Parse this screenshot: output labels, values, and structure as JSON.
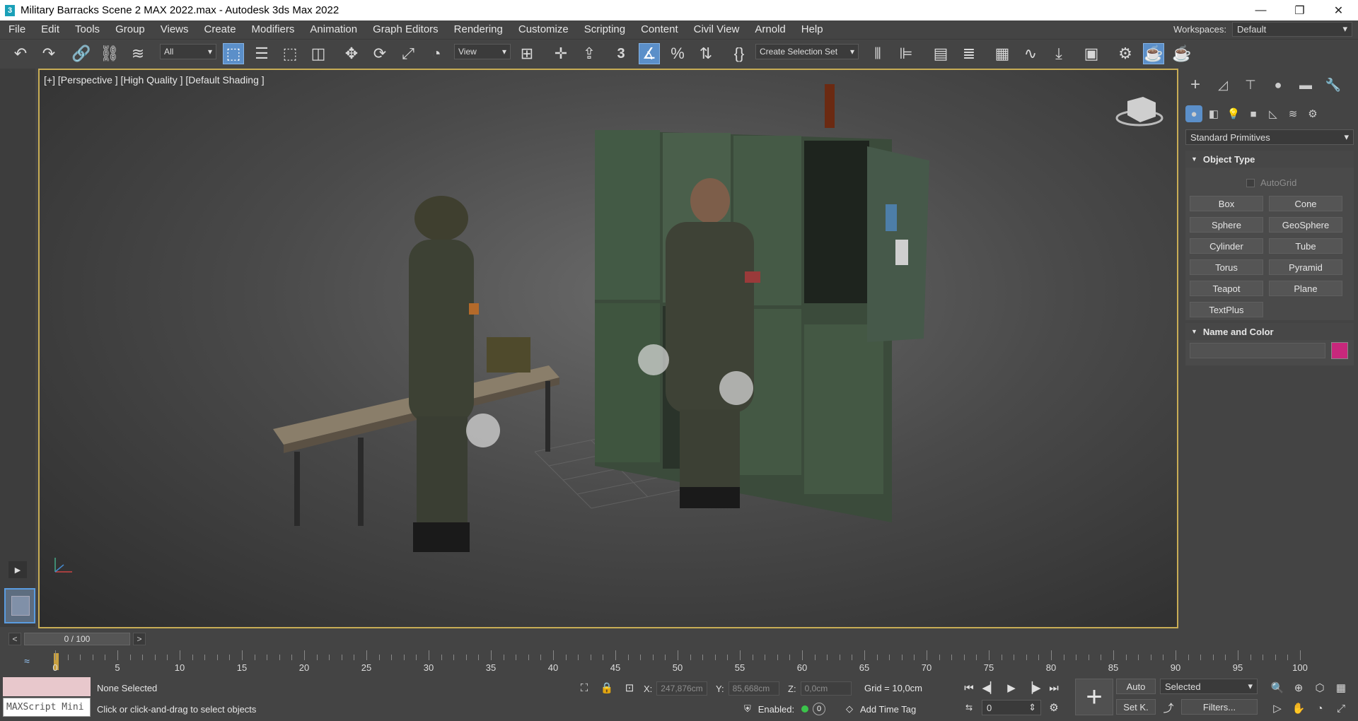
{
  "window": {
    "title": "Military Barracks Scene 2 MAX 2022.max - Autodesk 3ds Max 2022",
    "app_icon": "3",
    "minimize": "—",
    "restore": "❐",
    "close": "✕"
  },
  "menu": {
    "items": [
      "File",
      "Edit",
      "Tools",
      "Group",
      "Views",
      "Create",
      "Modifiers",
      "Animation",
      "Graph Editors",
      "Rendering",
      "Customize",
      "Scripting",
      "Content",
      "Civil View",
      "Arnold",
      "Help"
    ],
    "workspaces_label": "Workspaces:",
    "workspaces_value": "Default"
  },
  "toolbar": {
    "selection_filter": "All",
    "reference_coord": "View",
    "selection_set": "Create Selection Set",
    "snap_label": "3"
  },
  "viewport": {
    "label": "[+] [Perspective ] [High Quality ] [Default Shading ]"
  },
  "command_panel": {
    "category_dropdown": "Standard Primitives",
    "object_type_title": "Object Type",
    "autogrid_label": "AutoGrid",
    "buttons": [
      "Box",
      "Cone",
      "Sphere",
      "GeoSphere",
      "Cylinder",
      "Tube",
      "Torus",
      "Pyramid",
      "Teapot",
      "Plane",
      "TextPlus"
    ],
    "name_color_title": "Name and Color",
    "name_value": "",
    "object_color": "#c8287c"
  },
  "timeline": {
    "frame_display": "0 / 100",
    "prev": "<",
    "next": ">",
    "ticks": [
      "0",
      "5",
      "10",
      "15",
      "20",
      "25",
      "30",
      "35",
      "40",
      "45",
      "50",
      "55",
      "60",
      "65",
      "70",
      "75",
      "80",
      "85",
      "90",
      "95",
      "100"
    ]
  },
  "status": {
    "maxscript_label": "MAXScript Mini",
    "selection_text": "None Selected",
    "prompt_text": "Click or click-and-drag to select objects",
    "x_label": "X:",
    "x_value": "247,876cm",
    "y_label": "Y:",
    "y_value": "85,668cm",
    "z_label": "Z:",
    "z_value": "0,0cm",
    "grid_text": "Grid = 10,0cm",
    "enabled_label": "Enabled:",
    "enabled_count": "0",
    "add_time_tag": "Add Time Tag",
    "auto_key": "Auto",
    "set_key": "Set K.",
    "key_filter_dd": "Selected",
    "filters_btn": "Filters...",
    "frame_field": "0"
  },
  "colors": {
    "accent": "#5b8fc9",
    "viewport_border": "#c8ad55",
    "status_green": "#3bc44b"
  }
}
